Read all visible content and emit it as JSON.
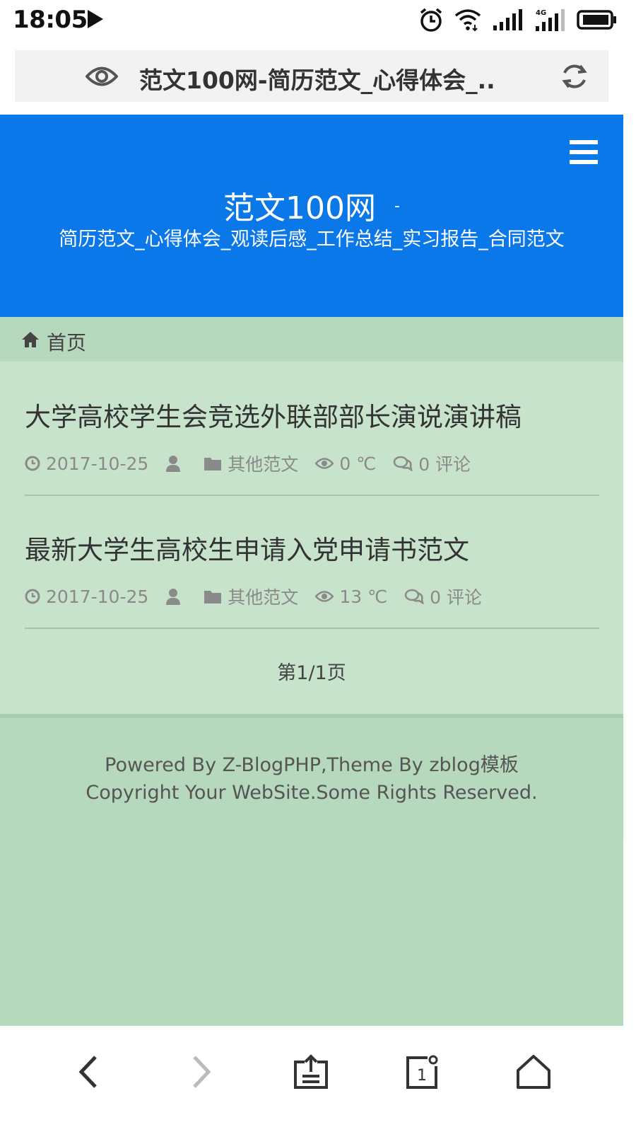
{
  "status_bar": {
    "time": "18:05",
    "icons": [
      "play-icon",
      "alarm-icon",
      "wifi-icon",
      "signal-icon",
      "signal-4g-icon",
      "battery-icon"
    ],
    "network_label": "4G"
  },
  "browser": {
    "page_title": "范文100网-简历范文_心得体会_..",
    "icons": [
      "eye-icon",
      "refresh-icon"
    ]
  },
  "header": {
    "site_name": "范文100网",
    "separator": "-",
    "tagline": "简历范文_心得体会_观读后感_工作总结_实习报告_合同范文",
    "bg_color": "#0a78e8"
  },
  "breadcrumb": {
    "home_label": "首页"
  },
  "posts": [
    {
      "title": "大学高校学生会竞选外联部部长演说演讲稿",
      "date": "2017-10-25",
      "category": "其他范文",
      "views": "0 ℃",
      "comments": "0 评论"
    },
    {
      "title": "最新大学生高校生申请入党申请书范文",
      "date": "2017-10-25",
      "category": "其他范文",
      "views": "13 ℃",
      "comments": "0 评论"
    }
  ],
  "pager": {
    "label": "第1/1页"
  },
  "footer": {
    "powered": "Powered By Z-BlogPHP,Theme By zblog模板",
    "copyright": "Copyright Your WebSite.Some Rights Reserved."
  },
  "bottom_nav": {
    "tab_count": "1",
    "icons": [
      "back-icon",
      "forward-icon",
      "share-icon",
      "tabs-icon",
      "home-icon"
    ]
  }
}
